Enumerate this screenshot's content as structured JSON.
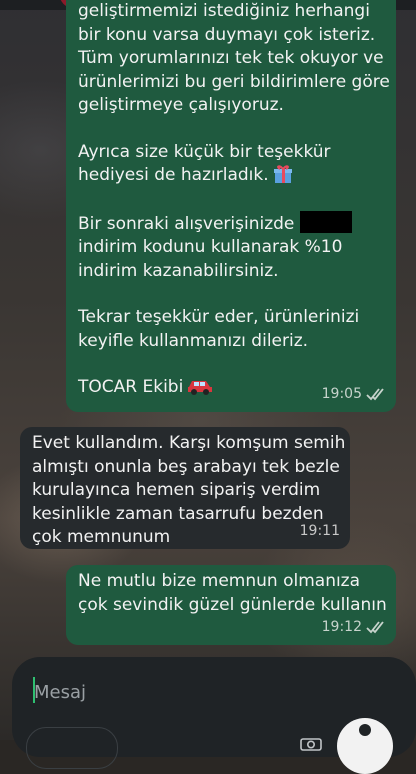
{
  "messages": [
    {
      "direction": "outgoing",
      "paragraphs": [
        [
          "geliştirmemizi istediğiniz herhangi",
          "bir konu varsa duymayı çok isteriz.",
          "Tüm yorumlarınızı tek tek okuyor ve",
          "ürünlerimizi bu geri bildirimlere göre",
          "geliştirmeye çalışıyoruz."
        ],
        [
          "Ayrıca size küçük bir teşekkür",
          "hediyesi de hazırladık."
        ],
        [
          "Bir sonraki alışverişinizde",
          "indirim kodunu kullanarak %10",
          "indirim kazanabilirsiniz."
        ],
        [
          "Tekrar teşekkür eder, ürünlerinizi",
          "keyifle kullanmanızı dileriz."
        ],
        [
          "TOCAR Ekibi"
        ]
      ],
      "time": "19:05",
      "gift_icon": "gift-emoji",
      "car_icon": "car-emoji",
      "status_icon": "double-check-read"
    },
    {
      "direction": "incoming",
      "lines": [
        "Evet kullandım. Karşı komşum semih",
        "almıştı onunla beş arabayı tek bezle",
        "kurulayınca hemen sipariş verdim",
        "kesinlikle zaman tasarrufu bezden",
        "çok memnunum"
      ],
      "time": "19:11"
    },
    {
      "direction": "outgoing",
      "lines": [
        "Ne mutlu bize memnun olmanıza",
        "çok sevindik güzel günlerde kullanın"
      ],
      "time": "19:12",
      "status_icon": "double-check-read"
    }
  ],
  "composer": {
    "placeholder": "Mesaj",
    "value": ""
  },
  "colors": {
    "outgoing_bubble": "#1f5a3f",
    "incoming_bubble": "#262a2d",
    "accent": "#2fbf71"
  }
}
